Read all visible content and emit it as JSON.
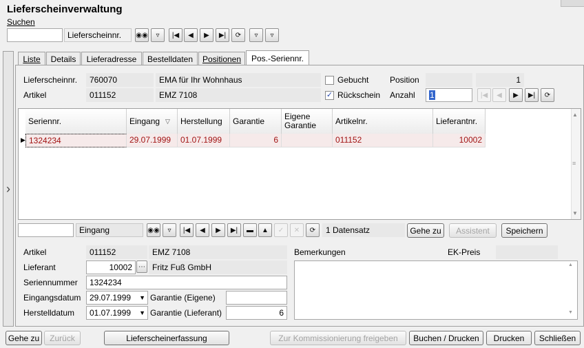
{
  "window": {
    "title": "Lieferscheinverwaltung"
  },
  "search": {
    "label": "Suchen",
    "value": "",
    "field": "Lieferscheinnr."
  },
  "tabs": [
    {
      "label": "Liste"
    },
    {
      "label": "Details"
    },
    {
      "label": "Lieferadresse"
    },
    {
      "label": "Bestelldaten"
    },
    {
      "label": "Positionen"
    },
    {
      "label": "Pos.-Seriennr."
    }
  ],
  "header": {
    "lieferscheinnr_label": "Lieferscheinnr.",
    "lieferscheinnr": "760070",
    "kunde": "EMA für Ihr Wohnhaus",
    "artikel_label": "Artikel",
    "artikel": "011152",
    "artikel_name": "EMZ 7108",
    "gebucht_label": "Gebucht",
    "gebucht_checked": false,
    "rueckschein_label": "Rückschein",
    "rueckschein_checked": true,
    "position_label": "Position",
    "position_value": "",
    "position_num": "1",
    "anzahl_label": "Anzahl",
    "anzahl_value": "1"
  },
  "table": {
    "columns": [
      "Seriennr.",
      "Eingang",
      "Herstellung",
      "Garantie",
      "Eigene Garantie",
      "Artikelnr.",
      "Lieferantnr."
    ],
    "rows": [
      [
        "1324234",
        "29.07.1999",
        "01.07.1999",
        "6",
        "",
        "011152",
        "10002"
      ]
    ]
  },
  "navbar": {
    "search_value": "",
    "field": "Eingang",
    "record_count": "1 Datensatz",
    "goto_label": "Gehe zu",
    "assistant_label": "Assistent",
    "save_label": "Speichern"
  },
  "detail": {
    "artikel_label": "Artikel",
    "artikel": "011152",
    "artikel_name": "EMZ 7108",
    "lieferant_label": "Lieferant",
    "lieferant": "10002",
    "lieferant_name": "Fritz Fuß GmbH",
    "seriennummer_label": "Seriennummer",
    "seriennummer": "1324234",
    "eingangsdatum_label": "Eingangsdatum",
    "eingangsdatum": "29.07.1999",
    "herstelldatum_label": "Herstelldatum",
    "herstelldatum": "01.07.1999",
    "garantie_eigene_label": "Garantie (Eigene)",
    "garantie_eigene": "",
    "garantie_lieferant_label": "Garantie (Lieferant)",
    "garantie_lieferant": "6",
    "bemerkungen_label": "Bemerkungen",
    "bemerkungen": "",
    "ekpreis_label": "EK-Preis",
    "ekpreis": ""
  },
  "footer": {
    "goto": "Gehe zu",
    "back": "Zurück",
    "erfassung": "Lieferscheinerfassung",
    "kommission": "Zur Kommissionierung freigeben",
    "buchen_drucken": "Buchen / Drucken",
    "drucken": "Drucken",
    "schliessen": "Schließen"
  }
}
